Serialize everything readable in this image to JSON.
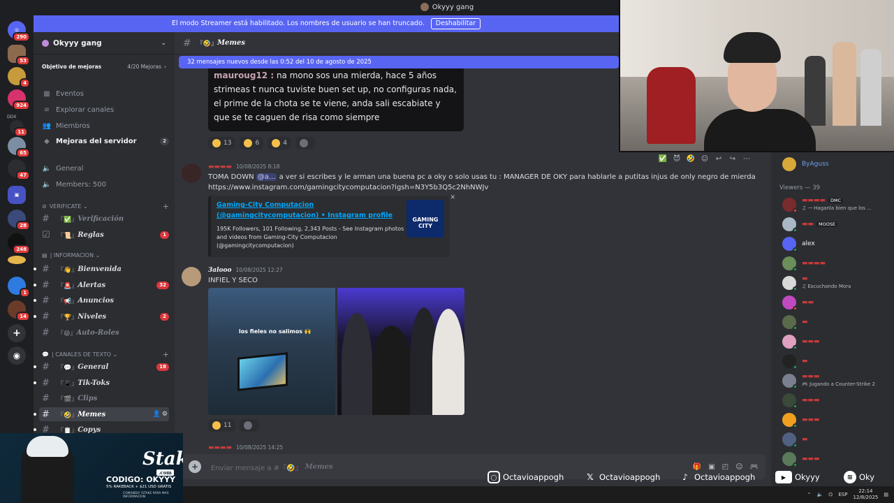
{
  "window": {
    "title": "Okyyy gang"
  },
  "banner": {
    "text": "El modo Streamer está habilitado. Los nombres de usuario se han truncado.",
    "button": "Deshabilitar"
  },
  "rail": {
    "badges": [
      "290",
      "53",
      "4",
      "924",
      "11",
      "65",
      "47",
      "28",
      "248",
      "1",
      "14"
    ],
    "ddx_label": "DDX"
  },
  "server": {
    "name": "Okyyy gang",
    "goal_label": "Objetivo de mejoras",
    "goal_progress": "4/20 Mejoras",
    "items": [
      {
        "label": "Eventos"
      },
      {
        "label": "Explorar canales"
      },
      {
        "label": "Miembros"
      },
      {
        "label": "Mejoras del servidor",
        "count": "2"
      },
      {
        "label": "General"
      },
      {
        "label": "Members: 500"
      }
    ],
    "categories": {
      "verificate": "VERIFICATE",
      "informacion": "| INFORMACION",
      "canales": "| CANALES DE TEXTO"
    },
    "channels": [
      {
        "name": "Verificación",
        "prefix": "『✅』"
      },
      {
        "name": "Reglas",
        "prefix": "『📜』",
        "count": "1"
      },
      {
        "name": "Bienvenida",
        "prefix": "『👋』"
      },
      {
        "name": "Alertas",
        "prefix": "『🚨』",
        "count": "32"
      },
      {
        "name": "Anuncios",
        "prefix": "『📢』"
      },
      {
        "name": "Niveles",
        "prefix": "『🏆』",
        "count": "2"
      },
      {
        "name": "Auto-Roles",
        "prefix": "『😄』"
      },
      {
        "name": "General",
        "prefix": "『💬』",
        "count": "18"
      },
      {
        "name": "Tik-Toks",
        "prefix": "『📱』"
      },
      {
        "name": "Clips",
        "prefix": "『🎬』"
      },
      {
        "name": "Memes",
        "prefix": "『🤣』"
      },
      {
        "name": "Copys",
        "prefix": "『📋』"
      }
    ]
  },
  "chat": {
    "channel_name": "Memes",
    "channel_prefix": "『🤣』",
    "new_messages": "32 mensajes nuevos desde las 0:52 del 10 de agosto de 2025",
    "quote": {
      "user": "mauroug12 :",
      "text": "na mono sos una mierda, hace 5 años strimeas t nunca tuviste buen set up, no configuras nada, el prime de la chota se te viene, anda sali escabiate y que se te caguen de risa como siempre"
    },
    "quote_reactions": [
      {
        "count": "13"
      },
      {
        "count": "6"
      },
      {
        "count": "4"
      }
    ],
    "msg1": {
      "time": "10/08/2025 8:18",
      "text_pre": "TOMA DOWN",
      "mention": "@a...",
      "text_post": "a ver si escribes y le arman una buena pc a oky o solo usas tu : MANAGER DE OKY para hablarle a putitas injus de only negro de mierda",
      "link": "https://www.instagram.com/gamingcitycomputacion?igsh=N3Y5b3Q5c2NhNWJv",
      "embed_title": "Gaming-City Computacion (@gamingcitycomputacion) • Instagram profile",
      "embed_desc": "195K Followers, 101 Following, 2,343 Posts - See Instagram photos and videos from Gaming-City Computacion (@gamingcitycomputacion)",
      "thumb_text": "GAMING CITY"
    },
    "msg2": {
      "user": "3alooo",
      "time": "10/08/2025 12:27",
      "text": "INFIEL Y SECO",
      "img_caption": "los fieles no salimos 🙌",
      "reaction_count": "11"
    },
    "msg3": {
      "time": "10/08/2025 14:25"
    },
    "composer_placeholder": "Enviar mensaje a #『🤣』",
    "composer_channel": "Memes"
  },
  "members": {
    "top_name": "ByAguss",
    "section": "Viewers — 39",
    "list": [
      {
        "name": "",
        "tag": "DMC",
        "status": "♫ ·─ Hagan​la bien que los ..."
      },
      {
        "name": "",
        "tag": "MOOSE",
        "status": ""
      },
      {
        "name": "alex",
        "tag": "",
        "status": ""
      },
      {
        "name": "",
        "tag": "",
        "status": ""
      },
      {
        "name": "",
        "tag": "",
        "status": "♫ Escuchando Mora"
      },
      {
        "name": "",
        "tag": "",
        "status": ""
      },
      {
        "name": "",
        "tag": "",
        "status": ""
      },
      {
        "name": "",
        "tag": "",
        "status": ""
      },
      {
        "name": "",
        "tag": "",
        "status": ""
      },
      {
        "name": "",
        "tag": "",
        "status": "🎮 Jugando a Counter-Strike 2"
      },
      {
        "name": "",
        "tag": "",
        "status": ""
      },
      {
        "name": "",
        "tag": "",
        "status": ""
      },
      {
        "name": "",
        "tag": "",
        "status": ""
      },
      {
        "name": "",
        "tag": "",
        "status": ""
      }
    ]
  },
  "ad": {
    "brand": "Stake",
    "brand_suffix": ".com",
    "code": "CODIGO: OKYYY",
    "offer": "5% RAKEBACK + $21 USD GRATIS",
    "fine": "COMANDO !STAKE PARA MAS INFORMACION"
  },
  "social": {
    "instagram": "Octavioappogh",
    "x": "Octavioappogh",
    "tiktok": "Octavioappogh",
    "youtube": "Okyyy",
    "spotify": "Oky"
  },
  "taskbar": {
    "lang": "ESP",
    "time": "22:14",
    "date": "12/8/2025"
  },
  "colors": {
    "blurple": "#5865f2",
    "danger": "#da373c",
    "online": "#23a55a",
    "link": "#00a8fc"
  }
}
